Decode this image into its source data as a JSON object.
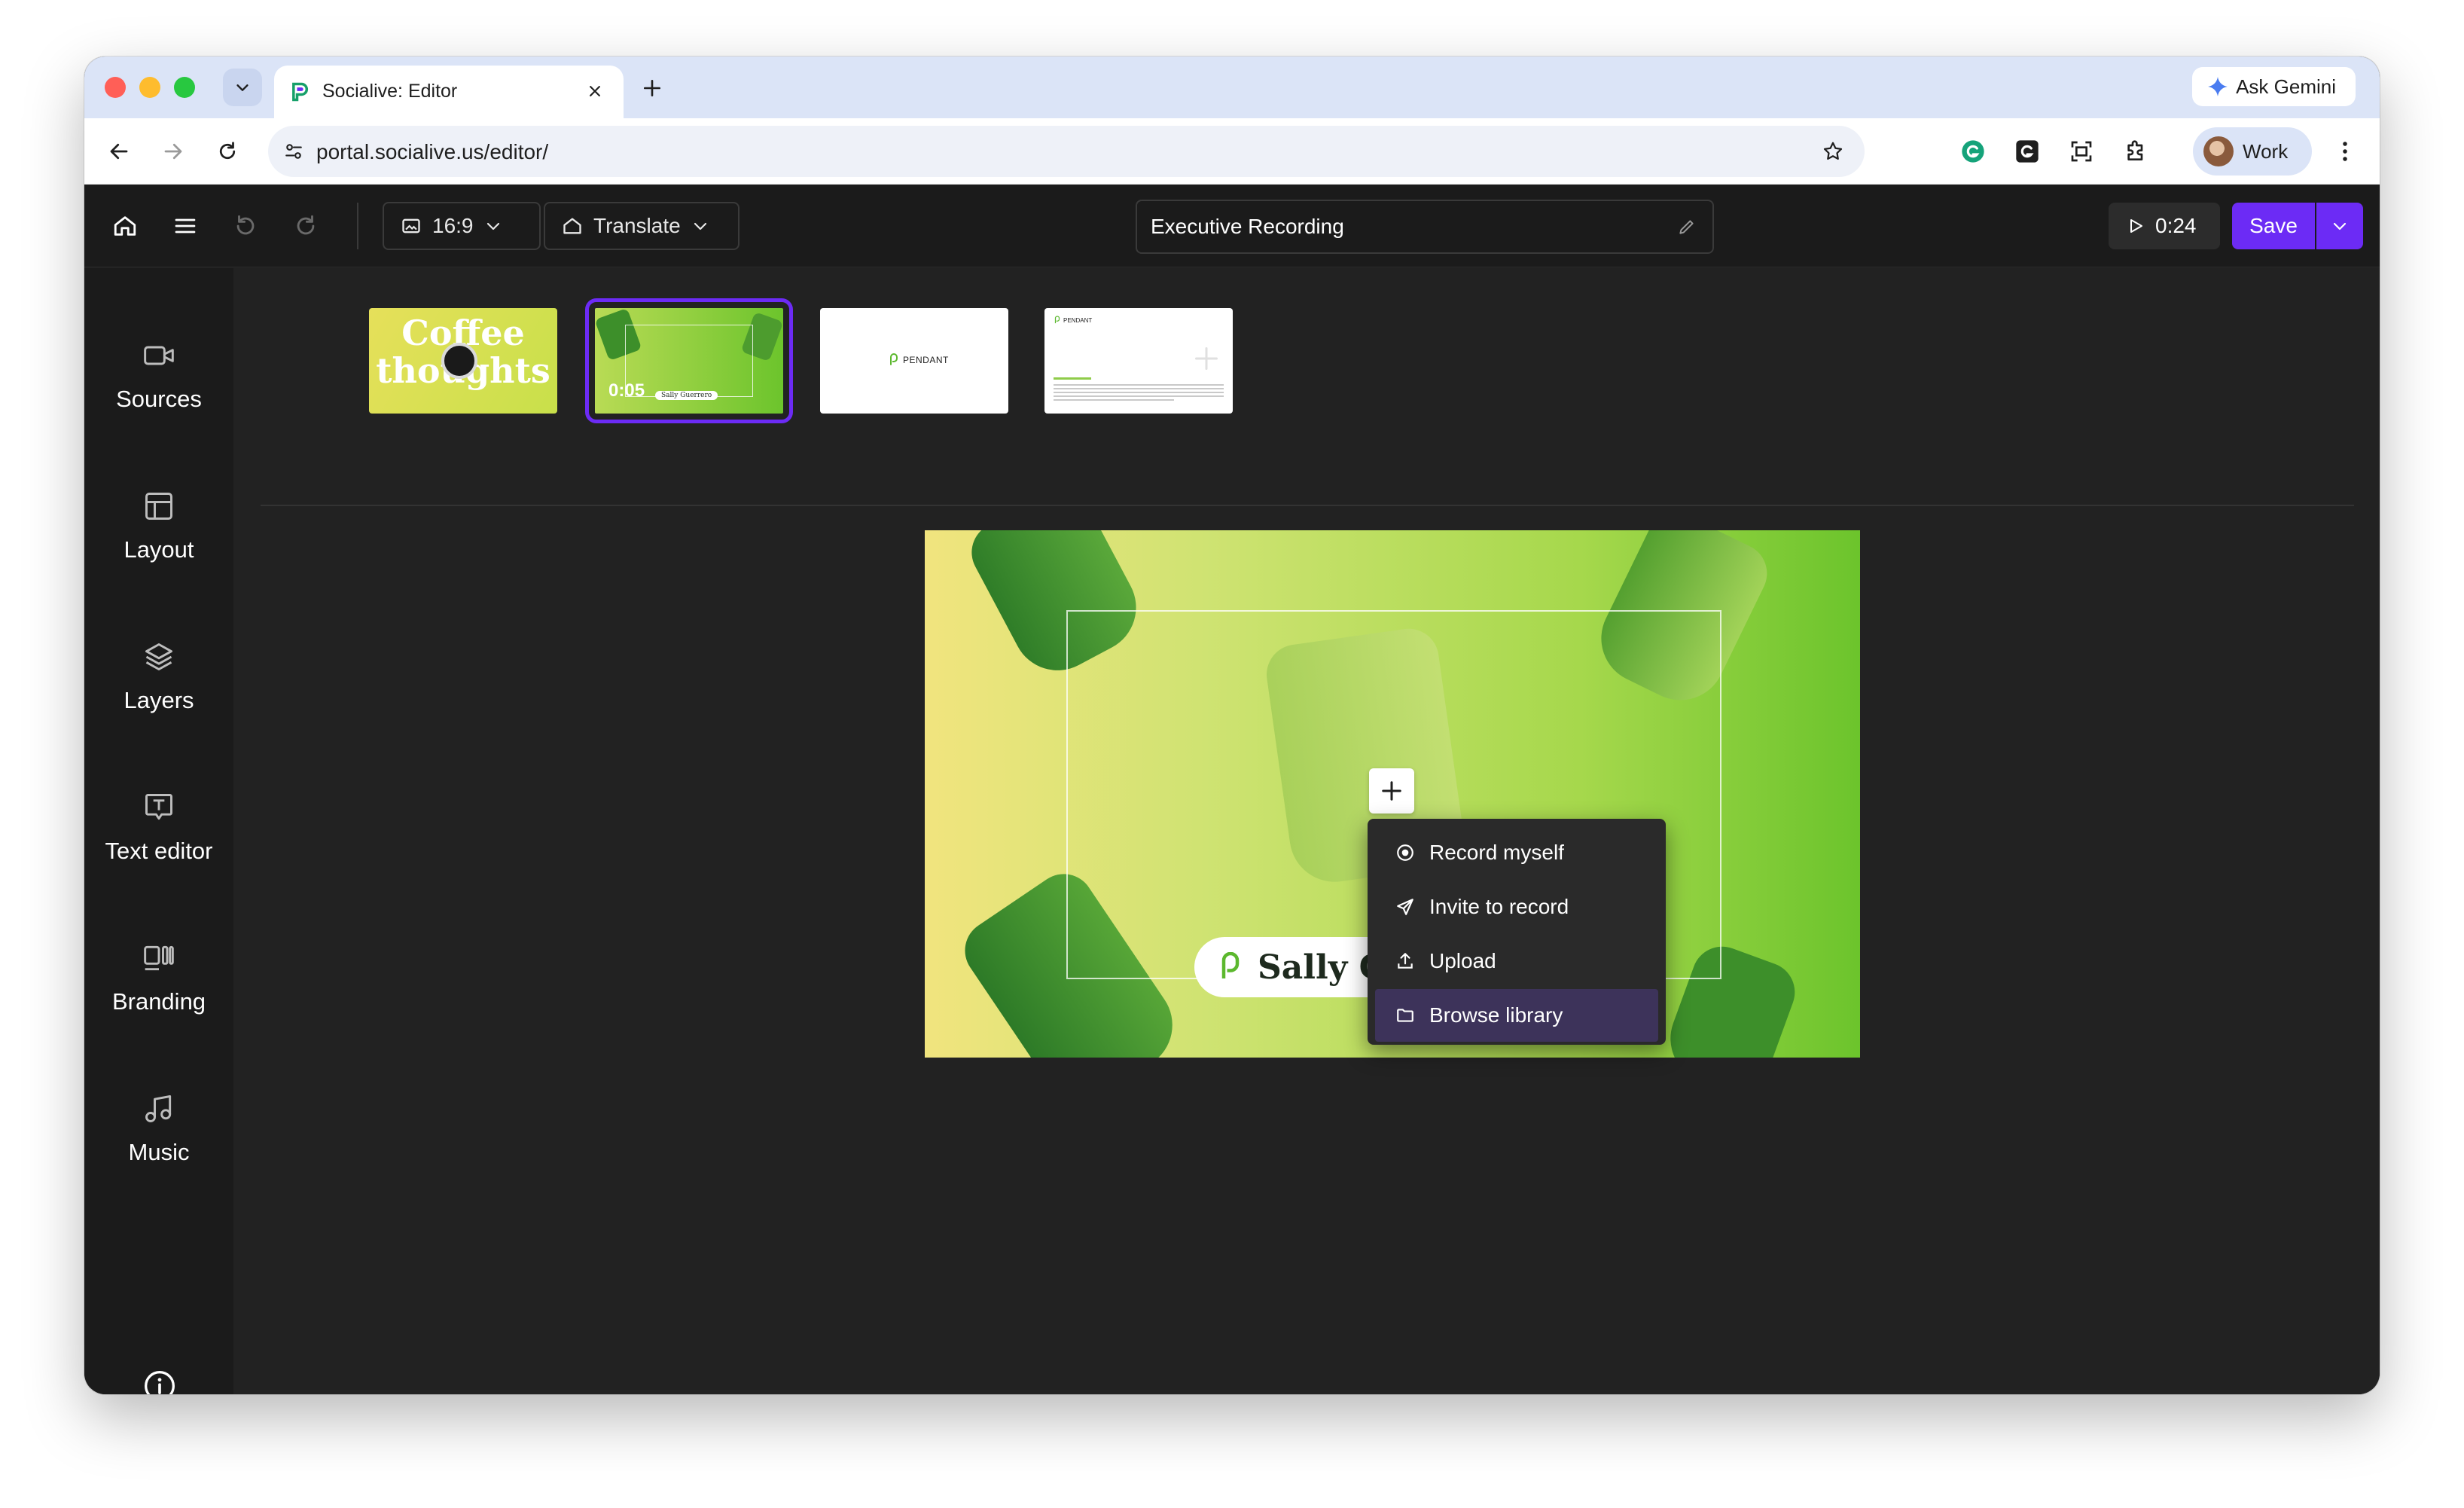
{
  "browser": {
    "tab_title": "Socialive: Editor",
    "url": "portal.socialive.us/editor/",
    "ask_gemini_label": "Ask Gemini",
    "profile_label": "Work"
  },
  "header": {
    "aspect_ratio": "16:9",
    "translate_label": "Translate",
    "recording_title": "Executive Recording",
    "duration": "0:24",
    "save_label": "Save"
  },
  "sidebar": {
    "items": [
      {
        "label": "Sources",
        "icon": "video-camera-icon"
      },
      {
        "label": "Layout",
        "icon": "layout-icon"
      },
      {
        "label": "Layers",
        "icon": "layers-icon"
      },
      {
        "label": "Text editor",
        "icon": "text-box-icon"
      },
      {
        "label": "Branding",
        "icon": "branding-icon"
      },
      {
        "label": "Music",
        "icon": "music-note-icon"
      }
    ]
  },
  "slides": [
    {
      "title_line1": "Coffee",
      "title_line2": "thoughts"
    },
    {
      "duration": "0:05",
      "caption": "Sally Guerrero"
    },
    {
      "brand": "PENDANT"
    },
    {
      "brand": "PENDANT"
    }
  ],
  "canvas": {
    "nameplate": "Sally G"
  },
  "add_menu": {
    "items": [
      {
        "label": "Record myself",
        "icon": "record-circle-icon"
      },
      {
        "label": "Invite to record",
        "icon": "send-icon"
      },
      {
        "label": "Upload",
        "icon": "upload-icon"
      },
      {
        "label": "Browse library",
        "icon": "folder-icon"
      }
    ],
    "highlighted_index": 3
  },
  "colors": {
    "accent": "#6c2bf5",
    "app_background": "#222222",
    "menu_highlight": "#3d335a"
  }
}
